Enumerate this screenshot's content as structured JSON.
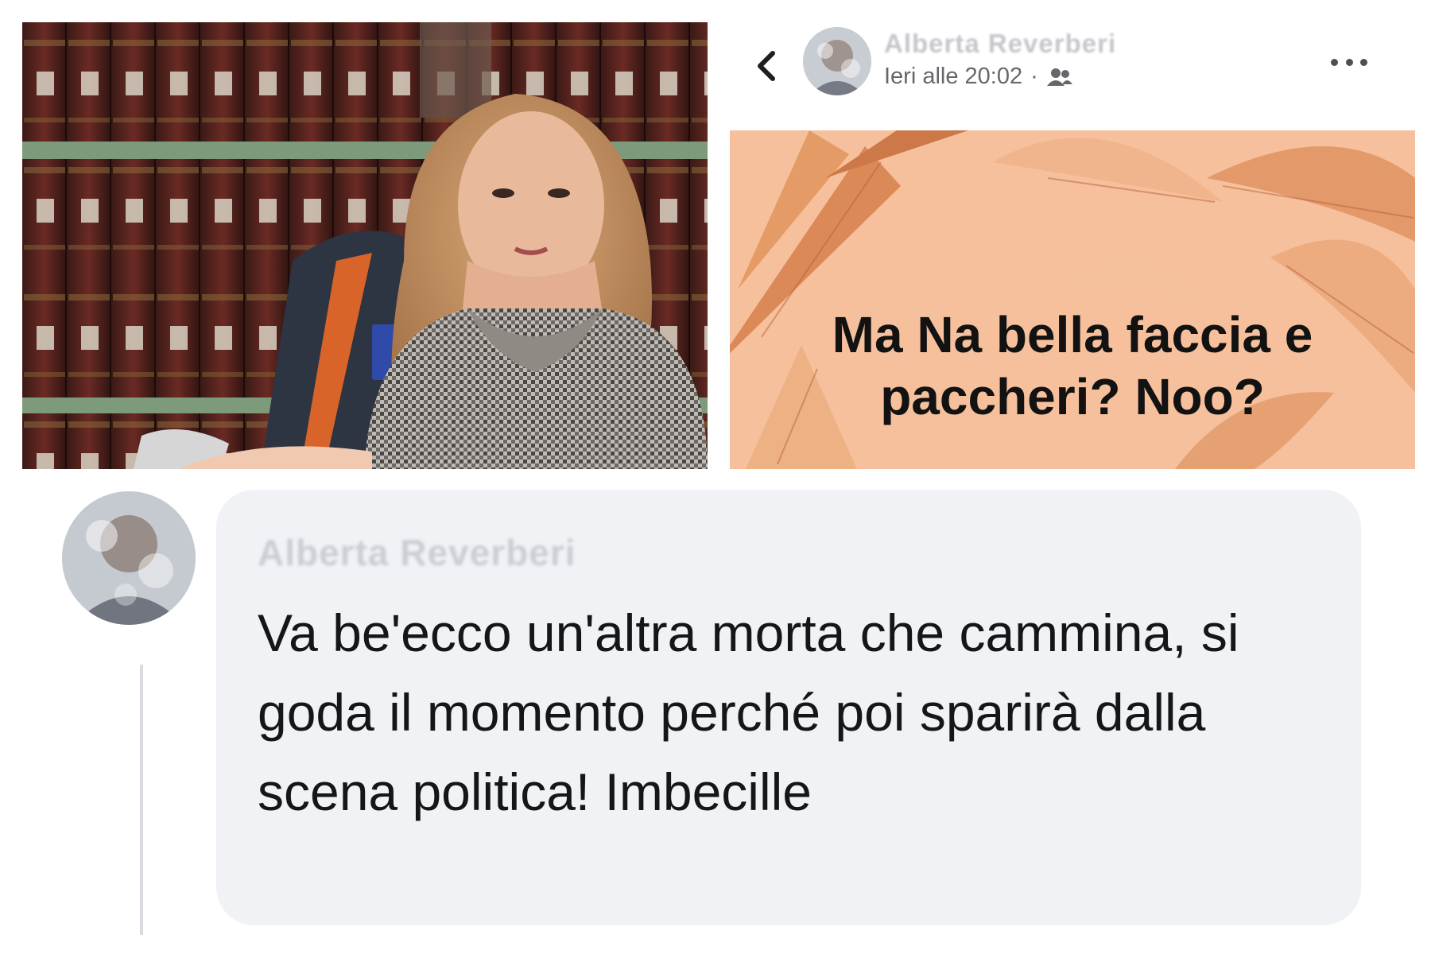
{
  "post": {
    "author_name": "Alberta Reverberi",
    "timestamp": "Ieri alle 20:02",
    "separator": "·",
    "audience_icon": "friends-icon",
    "back_icon": "chevron-left-icon",
    "more_icon": "more-horizontal-icon",
    "card_text": "Ma Na bella faccia e paccheri? Noo?",
    "card_background": "#f6c09d"
  },
  "comment": {
    "author_name": "Alberta Reverberi",
    "text": "Va be'ecco un'altra morta che cammina, si goda il momento perché poi sparirà dalla scena politica! Imbecille",
    "bubble_color": "#f0f2f5"
  }
}
